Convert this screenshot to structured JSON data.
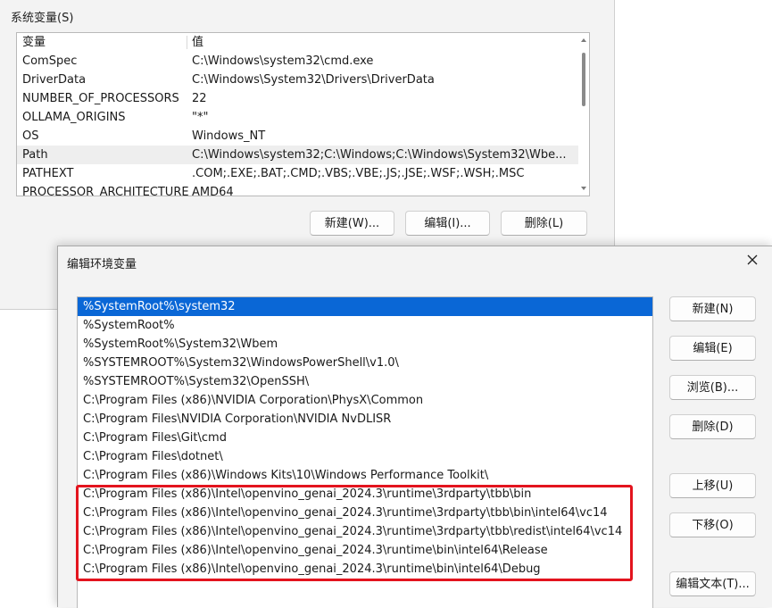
{
  "system_vars": {
    "title": "系统变量(S)",
    "columns": {
      "name": "变量",
      "value": "值"
    },
    "rows": [
      {
        "name": "ComSpec",
        "value": "C:\\Windows\\system32\\cmd.exe"
      },
      {
        "name": "DriverData",
        "value": "C:\\Windows\\System32\\Drivers\\DriverData"
      },
      {
        "name": "NUMBER_OF_PROCESSORS",
        "value": "22"
      },
      {
        "name": "OLLAMA_ORIGINS",
        "value": "\"*\""
      },
      {
        "name": "OS",
        "value": "Windows_NT"
      },
      {
        "name": "Path",
        "value": "C:\\Windows\\system32;C:\\Windows;C:\\Windows\\System32\\Wbe..."
      },
      {
        "name": "PATHEXT",
        "value": ".COM;.EXE;.BAT;.CMD;.VBS;.VBE;.JS;.JSE;.WSF;.WSH;.MSC"
      },
      {
        "name": "PROCESSOR_ARCHITECTURE",
        "value": "AMD64"
      }
    ],
    "buttons": {
      "new": "新建(W)...",
      "edit": "编辑(I)...",
      "delete": "删除(L)"
    }
  },
  "edit_dialog": {
    "title": "编辑环境变量",
    "paths": [
      "%SystemRoot%\\system32",
      "%SystemRoot%",
      "%SystemRoot%\\System32\\Wbem",
      "%SYSTEMROOT%\\System32\\WindowsPowerShell\\v1.0\\",
      "%SYSTEMROOT%\\System32\\OpenSSH\\",
      "C:\\Program Files (x86)\\NVIDIA Corporation\\PhysX\\Common",
      "C:\\Program Files\\NVIDIA Corporation\\NVIDIA NvDLISR",
      "C:\\Program Files\\Git\\cmd",
      "C:\\Program Files\\dotnet\\",
      "C:\\Program Files (x86)\\Windows Kits\\10\\Windows Performance Toolkit\\",
      "C:\\Program Files (x86)\\Intel\\openvino_genai_2024.3\\runtime\\3rdparty\\tbb\\bin",
      "C:\\Program Files (x86)\\Intel\\openvino_genai_2024.3\\runtime\\3rdparty\\tbb\\bin\\intel64\\vc14",
      "C:\\Program Files (x86)\\Intel\\openvino_genai_2024.3\\runtime\\3rdparty\\tbb\\redist\\intel64\\vc14",
      "C:\\Program Files (x86)\\Intel\\openvino_genai_2024.3\\runtime\\bin\\intel64\\Release",
      "C:\\Program Files (x86)\\Intel\\openvino_genai_2024.3\\runtime\\bin\\intel64\\Debug"
    ],
    "buttons": {
      "new": "新建(N)",
      "edit": "编辑(E)",
      "browse": "浏览(B)...",
      "delete": "删除(D)",
      "move_up": "上移(U)",
      "move_down": "下移(O)",
      "edit_text": "编辑文本(T)..."
    },
    "selection_color": "#0a67d6",
    "highlight_color": "#e3141e"
  }
}
